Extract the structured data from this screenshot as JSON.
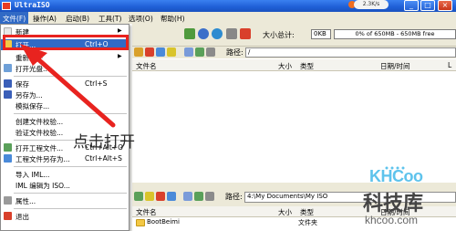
{
  "window": {
    "title": "UltraISO",
    "badge": "2.3K/s",
    "minimize_glyph": "_",
    "maximize_glyph": "□",
    "close_glyph": "×"
  },
  "menubar": {
    "items": [
      "文件(F)",
      "操作(A)",
      "启动(B)",
      "工具(T)",
      "选项(O)",
      "帮助(H)"
    ]
  },
  "toolbar": {
    "total_size_label": "大小总计:",
    "total_size_value": "0KB",
    "capacity_text": "0% of 650MB - 650MB free"
  },
  "upper": {
    "path_label": "路径:",
    "path_value": "/",
    "columns": [
      "文件名",
      "大小",
      "类型",
      "日期/时间",
      "L"
    ]
  },
  "lower": {
    "path_label": "路径:",
    "path_value": "4:\\My Documents\\My ISO",
    "columns": [
      "文件名",
      "大小",
      "类型",
      "日期/时间"
    ],
    "rows": [
      {
        "name": "BootBeimi",
        "type": "文件夹"
      }
    ]
  },
  "file_menu": {
    "items": [
      {
        "label": "新建",
        "shortcut": "",
        "submenu": true,
        "icon": "new-icon"
      },
      {
        "label": "打开...",
        "shortcut": "Ctrl+O",
        "submenu": false,
        "icon": "open-icon",
        "highlighted": true
      },
      {
        "label": "重新打开",
        "shortcut": "",
        "submenu": true,
        "icon": "reopen-icon"
      },
      {
        "label": "打开光盘...",
        "shortcut": "",
        "submenu": false,
        "icon": "open-disc-icon"
      },
      {
        "label": "保存",
        "shortcut": "Ctrl+S",
        "submenu": false,
        "icon": "save-icon"
      },
      {
        "label": "另存为...",
        "shortcut": "",
        "submenu": false,
        "icon": "save-as-icon"
      },
      {
        "label": "模拟保存...",
        "shortcut": "",
        "submenu": false,
        "icon": ""
      },
      {
        "label": "创建文件校验...",
        "shortcut": "",
        "submenu": false,
        "icon": ""
      },
      {
        "label": "验证文件校验...",
        "shortcut": "",
        "submenu": false,
        "icon": ""
      },
      {
        "label": "打开工程文件...",
        "shortcut": "Ctrl+Alt+O",
        "submenu": false,
        "icon": "open-project-icon"
      },
      {
        "label": "工程文件另存为...",
        "shortcut": "Ctrl+Alt+S",
        "submenu": false,
        "icon": "save-project-icon"
      },
      {
        "label": "导入 IML...",
        "shortcut": "",
        "submenu": false,
        "icon": ""
      },
      {
        "label": "IML 编辑为 ISO...",
        "shortcut": "",
        "submenu": false,
        "icon": ""
      },
      {
        "label": "属性...",
        "shortcut": "",
        "submenu": false,
        "icon": "properties-icon"
      },
      {
        "label": "退出",
        "shortcut": "",
        "submenu": false,
        "icon": "exit-icon"
      }
    ]
  },
  "annotation": {
    "text": "点击打开",
    "color": "#e8231f"
  },
  "watermark": {
    "logo": "KHCoo",
    "name": "科技库",
    "url": "khcoo.com"
  },
  "colors": {
    "titlebar": "#1f5fd6",
    "menu_highlight": "#316ac5",
    "annotation_red": "#e8231f",
    "watermark_blue": "#5ec3ec"
  }
}
